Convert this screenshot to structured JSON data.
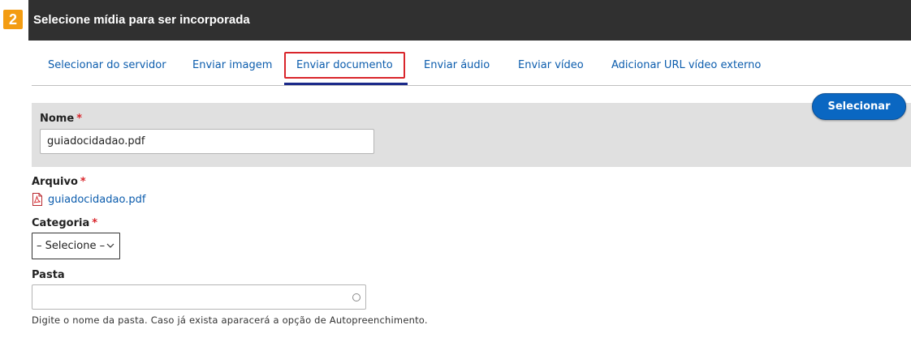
{
  "header": {
    "step_number": "2",
    "title": "Selecione mídia para ser incorporada"
  },
  "tabs": [
    {
      "label": "Selecionar do servidor"
    },
    {
      "label": "Enviar imagem"
    },
    {
      "label": "Enviar documento",
      "active": true
    },
    {
      "label": "Enviar áudio"
    },
    {
      "label": "Enviar vídeo"
    },
    {
      "label": "Adicionar URL vídeo externo"
    }
  ],
  "actions": {
    "select_label": "Selecionar"
  },
  "form": {
    "required_mark": "*",
    "name": {
      "label": "Nome",
      "value": "guiadocidadao.pdf"
    },
    "file": {
      "label": "Arquivo",
      "filename": "guiadocidadao.pdf",
      "icon": "pdf-file-icon"
    },
    "category": {
      "label": "Categoria",
      "selected": "– Selecione –"
    },
    "folder": {
      "label": "Pasta",
      "value": "",
      "help": "Digite o nome da pasta. Caso já exista aparacerá a opção de Autopreenchimento."
    }
  },
  "colors": {
    "header_bg": "#303030",
    "badge": "#f39c12",
    "link": "#0b5cad",
    "primary_button": "#0a67c2",
    "required": "#d9252b",
    "active_tab_underline": "#1b2a8a",
    "panel_bg": "#e0e0e0"
  }
}
